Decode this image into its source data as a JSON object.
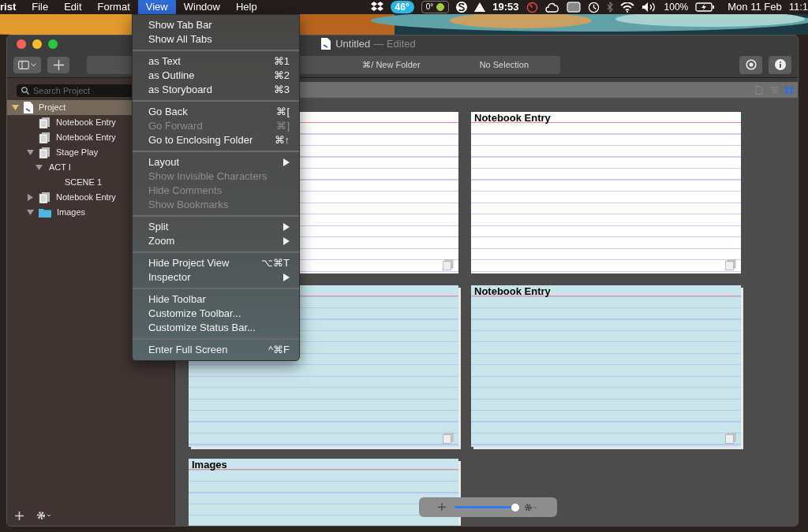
{
  "menu_bar": {
    "menus": [
      {
        "label": "rist",
        "selected": false
      },
      {
        "label": "File",
        "selected": false
      },
      {
        "label": "Edit",
        "selected": false
      },
      {
        "label": "Format",
        "selected": false
      },
      {
        "label": "View",
        "selected": true
      },
      {
        "label": "Window",
        "selected": false
      },
      {
        "label": "Help",
        "selected": false
      }
    ],
    "status": {
      "weather": "46°",
      "temperature": "0°",
      "timer": "19:53",
      "battery": "100%",
      "date": "Mon 11 Feb",
      "time": "11:1"
    }
  },
  "view_menu": [
    {
      "kind": "item",
      "label": "Show Tab Bar",
      "disabled": false
    },
    {
      "kind": "item",
      "label": "Show All Tabs",
      "disabled": false
    },
    {
      "kind": "separator"
    },
    {
      "kind": "item",
      "label": "as Text",
      "shortcut": "⌘1",
      "disabled": false
    },
    {
      "kind": "item",
      "label": "as Outline",
      "shortcut": "⌘2",
      "disabled": false
    },
    {
      "kind": "item",
      "label": "as Storyboard",
      "shortcut": "⌘3",
      "disabled": false
    },
    {
      "kind": "separator"
    },
    {
      "kind": "item",
      "label": "Go Back",
      "shortcut": "⌘[",
      "disabled": false
    },
    {
      "kind": "item",
      "label": "Go Forward",
      "shortcut": "⌘]",
      "disabled": true
    },
    {
      "kind": "item",
      "label": "Go to Enclosing Folder",
      "shortcut": "⌘↑",
      "disabled": false
    },
    {
      "kind": "separator"
    },
    {
      "kind": "submenu",
      "label": "Layout",
      "disabled": false
    },
    {
      "kind": "item",
      "label": "Show Invisible Characters",
      "disabled": true
    },
    {
      "kind": "item",
      "label": "Hide Comments",
      "disabled": true
    },
    {
      "kind": "item",
      "label": "Show Bookmarks",
      "disabled": true
    },
    {
      "kind": "separator"
    },
    {
      "kind": "submenu",
      "label": "Split",
      "disabled": false
    },
    {
      "kind": "submenu",
      "label": "Zoom",
      "disabled": false
    },
    {
      "kind": "separator"
    },
    {
      "kind": "item",
      "label": "Hide Project View",
      "shortcut": "⌥⌘T",
      "disabled": false
    },
    {
      "kind": "submenu",
      "label": "Inspector",
      "disabled": false
    },
    {
      "kind": "separator"
    },
    {
      "kind": "item",
      "label": "Hide Toolbar",
      "disabled": false
    },
    {
      "kind": "item",
      "label": "Customize Toolbar...",
      "disabled": false
    },
    {
      "kind": "item",
      "label": "Customize Status Bar...",
      "disabled": false
    },
    {
      "kind": "separator"
    },
    {
      "kind": "item",
      "label": "Enter Full Screen",
      "shortcut": "^⌘F",
      "disabled": false
    }
  ],
  "window": {
    "title": "Untitled",
    "edited": "— Edited",
    "toolbar": {
      "path": "⌘/ New Folder",
      "selection": "No Selection"
    },
    "search": {
      "placeholder": "Search Project"
    },
    "view_modes": [
      {
        "kind": "document",
        "selected": false
      },
      {
        "kind": "list",
        "selected": false
      },
      {
        "kind": "grid",
        "selected": true
      }
    ],
    "sidebar": {
      "items": [
        {
          "label": "Project",
          "kind": "project",
          "selected": true,
          "expanded": true,
          "children": [
            {
              "label": "Notebook Entry",
              "kind": "document",
              "selected": false
            },
            {
              "label": "Notebook Entry",
              "kind": "document",
              "selected": false
            },
            {
              "label": "Stage Play",
              "kind": "document",
              "selected": false,
              "expanded": true,
              "children": [
                {
                  "label": "ACT I",
                  "selected": false,
                  "expanded": true,
                  "children": [
                    {
                      "label": "SCENE 1",
                      "selected": false
                    }
                  ]
                }
              ]
            },
            {
              "label": "Notebook Entry",
              "kind": "document",
              "selected": false,
              "expanded": false
            },
            {
              "label": "Images",
              "kind": "folder",
              "selected": false,
              "expanded": true
            }
          ]
        }
      ]
    },
    "cards": [
      {
        "kind": "document"
      },
      {
        "kind": "document",
        "title": "Notebook Entry"
      },
      {
        "kind": "folder"
      },
      {
        "kind": "folder",
        "title": "Notebook Entry"
      },
      {
        "kind": "folder",
        "title": "Images"
      }
    ],
    "zoom": {
      "level": 1.0
    }
  }
}
